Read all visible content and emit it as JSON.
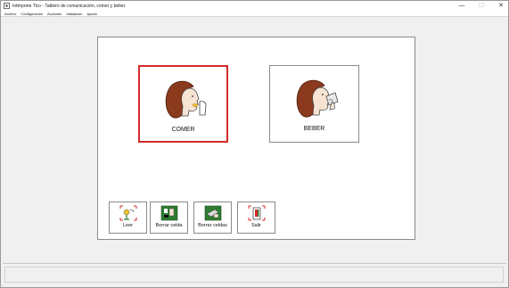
{
  "window": {
    "title": "Intérprete Tico - Tablero de comunicación, comer y beber",
    "minimize_glyph": "—",
    "maximize_glyph": "☐",
    "close_glyph": "✕"
  },
  "menu": [
    "Archivo",
    "Configuración",
    "Acciones",
    "Validación",
    "Ayuda"
  ],
  "board": {
    "cells": [
      {
        "label": "COMER",
        "icon": "person-eating-icon",
        "selected": true
      },
      {
        "label": "BEBER",
        "icon": "person-drinking-icon",
        "selected": false
      }
    ],
    "controls": [
      {
        "label": "Leer",
        "icon": "read-icon"
      },
      {
        "label": "Borrar celda",
        "icon": "delete-cell-icon"
      },
      {
        "label": "Borrar celdas",
        "icon": "delete-cells-icon"
      },
      {
        "label": "Salir",
        "icon": "exit-icon"
      }
    ]
  },
  "colors": {
    "selection_border": "#d42a2a",
    "hair": "#8b3a1e",
    "skin": "#f7e3d2",
    "pictogram_green": "#2e7d32"
  }
}
